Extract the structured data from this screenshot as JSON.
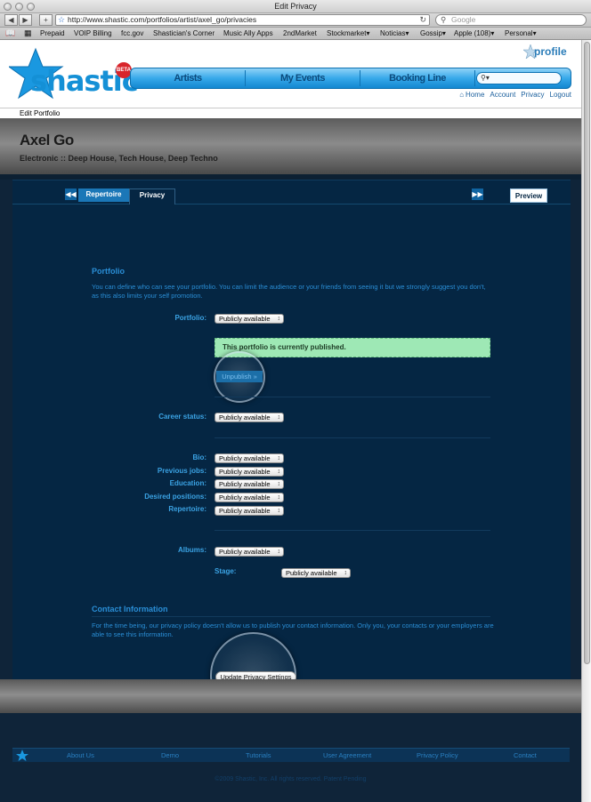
{
  "window": {
    "title": "Edit Privacy"
  },
  "browser": {
    "url": "http://www.shastic.com/portfolios/artist/axel_go/privacies",
    "search_placeholder": "Google",
    "bookmarks": [
      "Prepaid",
      "VOIP Billing",
      "fcc.gov",
      "Shastician's Corner",
      "Music Ally Apps",
      "2ndMarket",
      "Stockmarket▾",
      "Noticias▾",
      "Gossip▾",
      "Apple (108)▾",
      "Personal▾"
    ]
  },
  "header": {
    "logo_text": "shastic",
    "beta": "BETA",
    "profile": "profile",
    "nav": [
      "Artists",
      "My Events",
      "Booking Line"
    ],
    "links": [
      "Home",
      "Account",
      "Privacy",
      "Logout"
    ]
  },
  "breadcrumb": "Edit Portfolio",
  "artist": {
    "name": "Axel Go",
    "genres": "Electronic :: Deep House, Tech House, Deep Techno"
  },
  "tabs": {
    "repertoire": "Repertoire",
    "privacy": "Privacy",
    "preview": "Preview"
  },
  "portfolio_section": {
    "heading": "Portfolio",
    "description": "You can define who can see your portfolio. You can limit the audience or your friends from seeing it but we strongly suggest you don't, as this also limits your self promotion.",
    "portfolio_label": "Portfolio:",
    "portfolio_value": "Publicly available",
    "notice": "This portfolio is currently published.",
    "unpublish": "Unpublish »",
    "career_label": "Career status:",
    "career_value": "Publicly available",
    "fields": [
      {
        "label": "Bio:",
        "value": "Publicly available"
      },
      {
        "label": "Previous jobs:",
        "value": "Publicly available"
      },
      {
        "label": "Education:",
        "value": "Publicly available"
      },
      {
        "label": "Desired positions:",
        "value": "Publicly available"
      },
      {
        "label": "Repertoire:",
        "value": "Publicly available"
      }
    ],
    "albums_label": "Albums:",
    "albums_value": "Publicly available",
    "stage_label": "Stage:",
    "stage_value": "Publicly available"
  },
  "contact_section": {
    "heading": "Contact Information",
    "description": "For the time being, our privacy policy doesn't allow us to publish your contact information. Only you, your contacts or your employers are able to see this information.",
    "update_button": "Update Privacy Settings"
  },
  "footer": {
    "links": [
      "About Us",
      "Demo",
      "Tutorials",
      "User Agreement",
      "Privacy Policy",
      "Contact"
    ],
    "copyright": "©2009 Shastic, Inc. All rights reserved. Patent Pending"
  },
  "colors": {
    "brand": "#1490d6",
    "panel": "#052643",
    "accent": "#3ba3e4",
    "notice": "#9ee8b5"
  }
}
